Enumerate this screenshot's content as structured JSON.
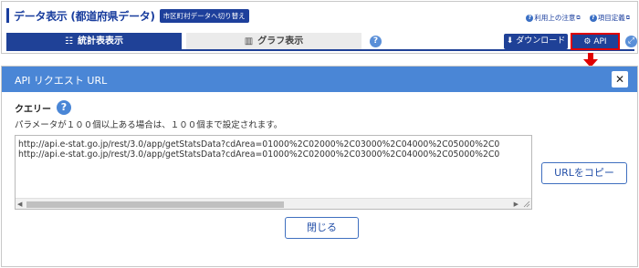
{
  "header": {
    "title": "データ表示 (都道府県データ)",
    "switch_label": "市区町村データへ切り替え",
    "links": {
      "usage_notes": "利用上の注意",
      "item_definitions": "項目定義"
    }
  },
  "tabs": {
    "table_view": "統計表表示",
    "graph_view": "グラフ表示"
  },
  "toolbar": {
    "download_label": "ダウンロード",
    "api_label": "API"
  },
  "modal": {
    "title": "API リクエスト URL",
    "query_label": "クエリー",
    "note": "パラメータが１００個以上ある場合は、１００個まで設定されます。",
    "urls": [
      "http://api.e-stat.go.jp/rest/3.0/app/getStatsData?cdArea=01000%2C02000%2C03000%2C04000%2C05000%2C0",
      "http://api.e-stat.go.jp/rest/3.0/app/getStatsData?cdArea=01000%2C02000%2C03000%2C04000%2C05000%2C0"
    ],
    "copy_label": "URLをコピー",
    "close_label": "閉じる"
  },
  "colors": {
    "brand_blue": "#1f4197",
    "modal_header": "#4a86d6",
    "highlight_red": "#e00000"
  }
}
